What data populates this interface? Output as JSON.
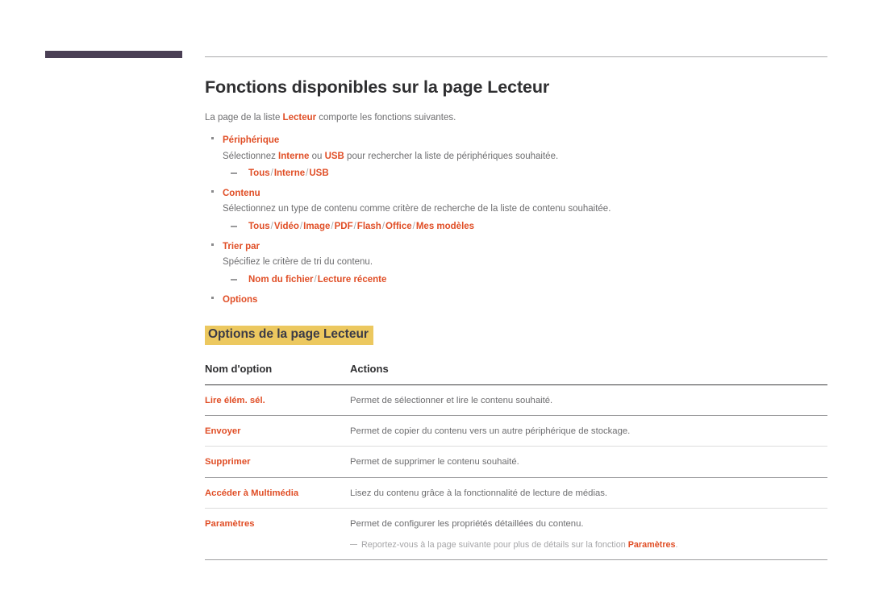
{
  "colors": {
    "accent_orange": "#e04e26",
    "header_bar_purple": "#4a3f55",
    "highlight_gold": "#ecc85f",
    "body_text_gray": "#6d6d6f",
    "heading_dark": "#2f2f31"
  },
  "header": {
    "bar_label": "decorative-purple-bar",
    "rule_label": "header-horizontal-rule"
  },
  "main": {
    "title": "Fonctions disponibles sur la page Lecteur",
    "intro": {
      "before": "La page de la liste ",
      "accent": "Lecteur",
      "after": " comporte les fonctions suivantes."
    },
    "bullets": [
      {
        "label": "Périphérique",
        "description_parts": [
          {
            "text": "Sélectionnez ",
            "accent": false
          },
          {
            "text": "Interne",
            "accent": true
          },
          {
            "text": " ou ",
            "accent": false
          },
          {
            "text": "USB",
            "accent": true
          },
          {
            "text": " pour rechercher la liste de périphériques souhaitée.",
            "accent": false
          }
        ],
        "options": [
          "Tous",
          "Interne",
          "USB"
        ]
      },
      {
        "label": "Contenu",
        "description_parts": [
          {
            "text": "Sélectionnez un type de contenu comme critère de recherche de la liste de contenu souhaitée.",
            "accent": false
          }
        ],
        "options": [
          "Tous",
          "Vidéo",
          "Image",
          "PDF",
          "Flash",
          "Office",
          "Mes modèles"
        ]
      },
      {
        "label": "Trier par",
        "description_parts": [
          {
            "text": "Spécifiez le critère de tri du contenu.",
            "accent": false
          }
        ],
        "options": [
          "Nom du fichier",
          "Lecture récente"
        ]
      },
      {
        "label": "Options",
        "description_parts": [],
        "options": []
      }
    ],
    "subtitle": "Options de la page Lecteur",
    "table": {
      "headers": [
        "Nom d'option",
        "Actions"
      ],
      "rows": [
        {
          "name": "Lire élém. sél.",
          "action": "Permet de sélectionner et lire le contenu souhaité."
        },
        {
          "name": "Envoyer",
          "action": "Permet de copier du contenu vers un autre périphérique de stockage."
        },
        {
          "name": "Supprimer",
          "action": "Permet de supprimer le contenu souhaité."
        },
        {
          "name": "Accéder à Multimédia",
          "action": "Lisez du contenu grâce à la fonctionnalité de lecture de médias."
        },
        {
          "name": "Paramètres",
          "action": "Permet de configurer les propriétés détaillées du contenu.",
          "note": {
            "before": "Reportez-vous à la page suivante pour plus de détails sur la fonction ",
            "accent": "Paramètres",
            "after": "."
          }
        }
      ]
    }
  }
}
